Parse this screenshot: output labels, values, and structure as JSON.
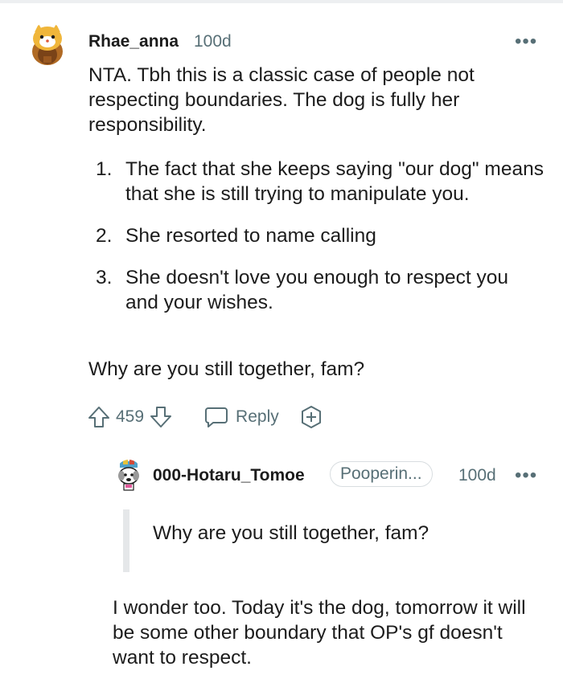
{
  "comment": {
    "username": "Rhae_anna",
    "age": "100d",
    "more": "•••",
    "intro": "NTA. Tbh this is a classic case of people not respecting boundaries. The dog is fully her responsibility.",
    "list": [
      {
        "num": "1.",
        "text": "The fact that she keeps saying \"our dog\" means that she is still trying to manipulate you."
      },
      {
        "num": "2.",
        "text": "She resorted to name calling"
      },
      {
        "num": "3.",
        "text": "She doesn't love you enough to respect you and your wishes."
      }
    ],
    "closing": "Why are you still together, fam?",
    "votes": "459",
    "reply_label": "Reply"
  },
  "reply": {
    "username": "000-Hotaru_Tomoe",
    "flair": "Pooperin...",
    "age": "100d",
    "more": "•••",
    "quote": "Why are you still together, fam?",
    "text": "I wonder too. Today it's the dog, tomorrow it will be some other boundary that OP's gf doesn't want to respect."
  },
  "colors": {
    "meta": "#576f76",
    "text": "#1c1c1c",
    "quote_bar": "#e5e7e9"
  }
}
